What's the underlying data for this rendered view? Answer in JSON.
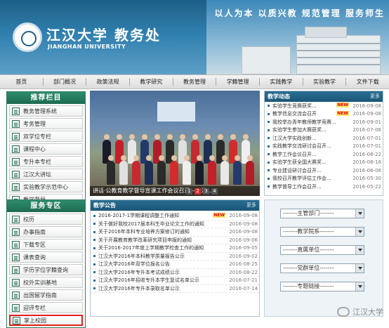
{
  "banner": {
    "motto": "以人为本 以质兴教 规范管理 服务师生",
    "university_cn": "江汉大学 教务处",
    "university_en": "JIANGHAN UNIVERSITY"
  },
  "nav": {
    "items": [
      "首页",
      "部门概况",
      "政策法规",
      "教学研究",
      "教务管理",
      "学籍管理",
      "实践教学",
      "实验教学",
      "文件下载"
    ]
  },
  "recommend": {
    "title": "推荐栏目",
    "items": [
      "教务管理系统",
      "考务管理",
      "双学位专栏",
      "课程中心",
      "专升本专栏",
      "江汉大讲坛",
      "实验教学示范中心",
      "教学督导"
    ]
  },
  "service": {
    "title": "服务专区",
    "items": [
      "校历",
      "办事指南",
      "下载专区",
      "课表查询",
      "学历学位学籍查询",
      "校外实训基地",
      "出国留学指南",
      "迎评专栏",
      "掌上校园"
    ]
  },
  "photo": {
    "caption": "讲话·公教育教学督导宣课工作会议召开——江...",
    "pages": [
      "1",
      "2",
      "3",
      "4"
    ],
    "active_page": 1
  },
  "news": {
    "title": "教学动态",
    "more": "更多",
    "items": [
      {
        "title": "实验学生竞赛获奖...",
        "date": "2016-09-08",
        "new": true
      },
      {
        "title": "教学信息交流会召开",
        "date": "2016-09-08",
        "new": true
      },
      {
        "title": "我校举办青年教师教学竞赛...",
        "date": "2016-09-01",
        "new": false
      },
      {
        "title": "实验学生参加大赛获奖...",
        "date": "2016-07-08",
        "new": false
      },
      {
        "title": "江汉大学实践创新...",
        "date": "2016-07-01",
        "new": false
      },
      {
        "title": "实践教学交流研讨会召开...",
        "date": "2016-07-01",
        "new": false
      },
      {
        "title": "教学工作会议召开...",
        "date": "2016-06-22",
        "new": false
      },
      {
        "title": "实验学生获全国大赛奖...",
        "date": "2016-06-16",
        "new": false
      },
      {
        "title": "专业建设研讨会召开...",
        "date": "2016-06-08",
        "new": false
      },
      {
        "title": "我校召开教学评估工作会...",
        "date": "2016-05-30",
        "new": false
      },
      {
        "title": "教学督导工作会召开...",
        "date": "2016-05-22",
        "new": false
      }
    ]
  },
  "notice": {
    "title": "教学公告",
    "more": "更多",
    "items": [
      {
        "title": "2016-2017-1学期课程调整工作通知",
        "date": "2016-09-08",
        "new": true
      },
      {
        "title": "关于做好我校2017届本科生毕业论文工作的通知",
        "date": "2016-09-08",
        "new": false
      },
      {
        "title": "关于2016年本科专业培养方案修订的通知",
        "date": "2016-09-08",
        "new": false
      },
      {
        "title": "关于开展教育教学改革研究项目申报的通知",
        "date": "2016-09-06",
        "new": false
      },
      {
        "title": "关于2016-2017年度上学期教学检查工作的通知",
        "date": "2016-09-05",
        "new": false
      },
      {
        "title": "江汉大学2016年本科教学质量报告公示",
        "date": "2016-09-02",
        "new": false
      },
      {
        "title": "江汉大学2016年双学位报名公告",
        "date": "2016-08-25",
        "new": false
      },
      {
        "title": "江汉大学2016年专升本考试成绩公示",
        "date": "2016-08-22",
        "new": false
      },
      {
        "title": "江汉大学2016年招收专升本学生复试名单公示",
        "date": "2016-07-21",
        "new": false
      },
      {
        "title": "江汉大学2016年专升本录取名单公示",
        "date": "2016-07-14",
        "new": false
      }
    ]
  },
  "selects": [
    "-------主管部门-------",
    "-------教学院系-------",
    "-------直属单位-------",
    "-------党群单位-------",
    "-------专题链接-------"
  ],
  "watermark": "江汉大学",
  "colors": {
    "banner": "#2f7fae",
    "green_header": "#1e6b52",
    "blue_header": "#1a5677",
    "highlight": "#e02020"
  }
}
